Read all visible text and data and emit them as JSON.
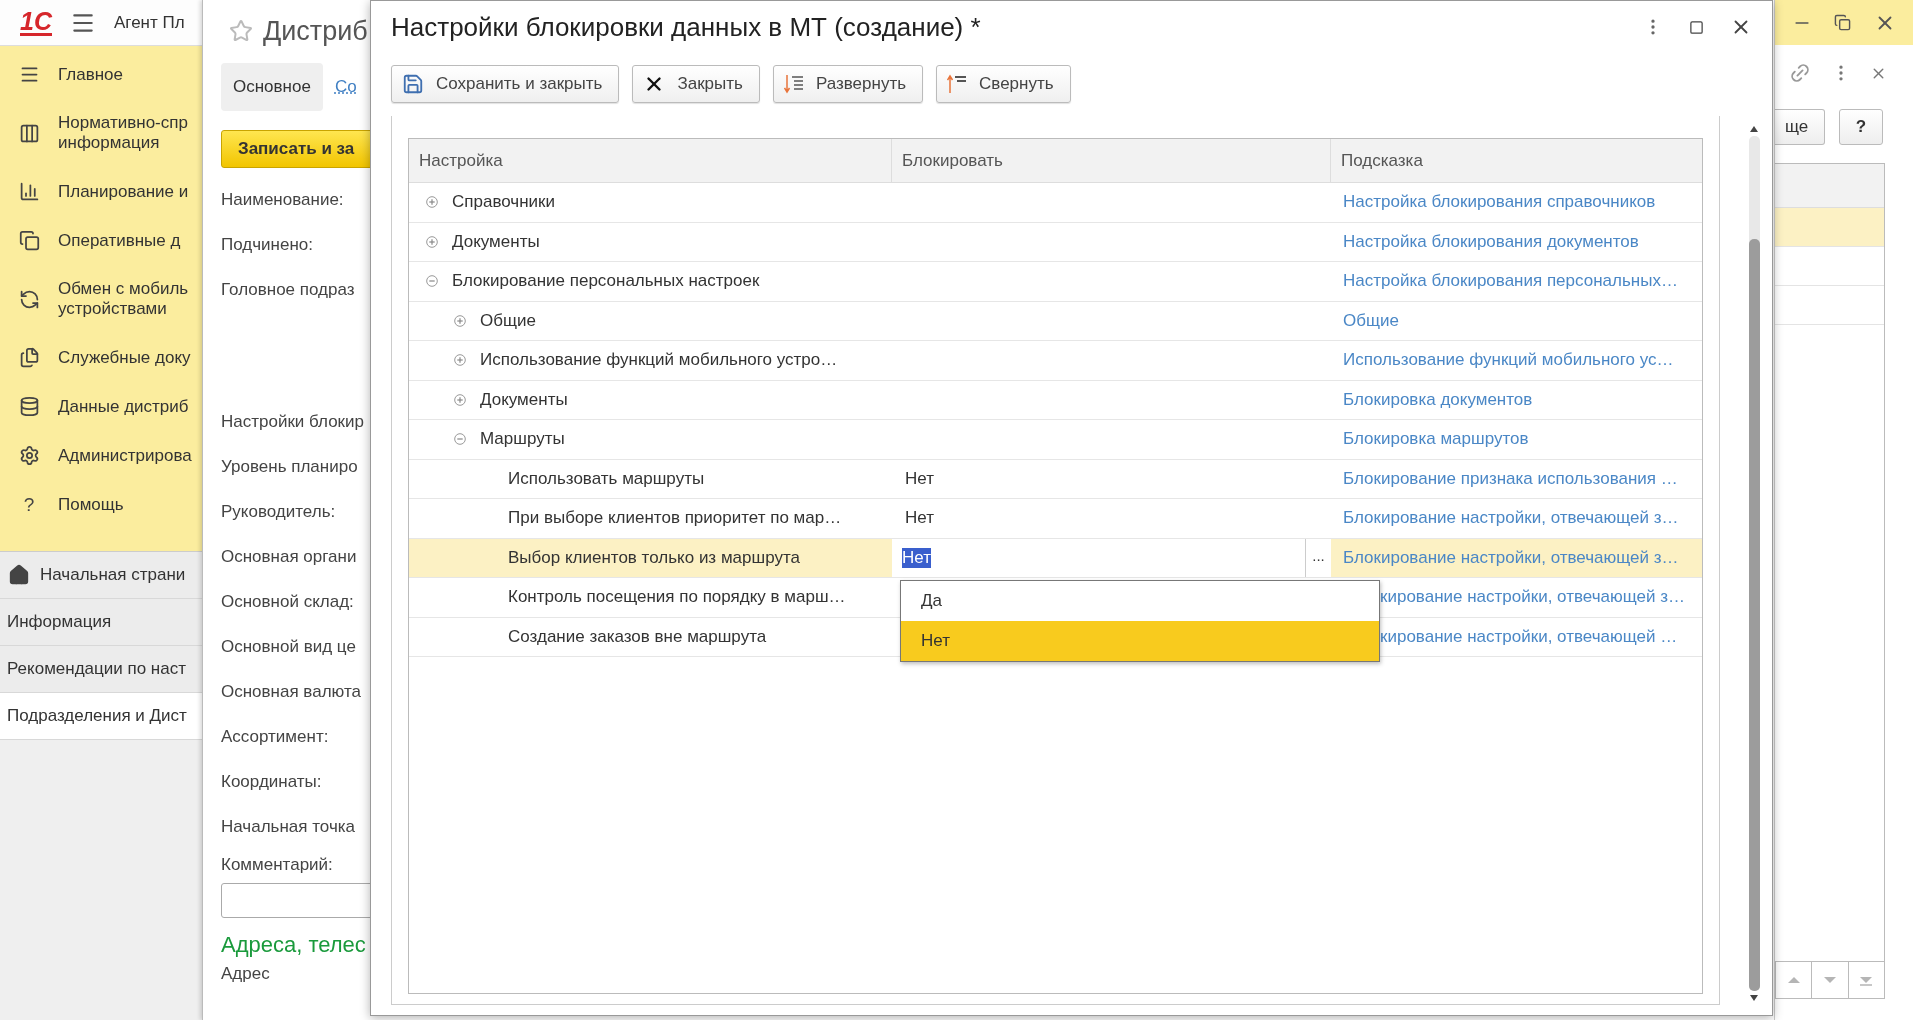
{
  "app": {
    "logo": "1С",
    "title": "Агент Пл"
  },
  "sections": [
    {
      "label": "Главное"
    },
    {
      "label": "Нормативно-спр информация"
    },
    {
      "label": "Планирование и"
    },
    {
      "label": "Оперативные д"
    },
    {
      "label": "Обмен с мобиль устройствами"
    },
    {
      "label": "Служебные доку"
    },
    {
      "label": "Данные дистриб"
    },
    {
      "label": "Администрирова"
    },
    {
      "label": "Помощь",
      "glyph": "?"
    }
  ],
  "nav": [
    {
      "label": "Начальная страни",
      "kind": "home",
      "selected": false
    },
    {
      "label": "Информация",
      "kind": "page",
      "selected": false
    },
    {
      "label": "Рекомендации по наст",
      "kind": "page",
      "selected": false
    },
    {
      "label": "Подразделения и Дист",
      "kind": "page",
      "selected": true
    }
  ],
  "form": {
    "title": "Дистриб",
    "tabs": [
      {
        "label": "Основное",
        "selected": true
      },
      {
        "label": "Со",
        "selected": false
      }
    ],
    "save_button": "Записать и за",
    "fields": [
      {
        "label": "Наименование:"
      },
      {
        "label": "Подчинено:"
      },
      {
        "label": "Головное подраз"
      },
      {
        "label": "Настройки блокир"
      },
      {
        "label": "Уровень планиро"
      },
      {
        "label": "Руководитель:"
      },
      {
        "label": "Основная органи"
      },
      {
        "label": "Основной склад:"
      },
      {
        "label": "Основной вид це"
      },
      {
        "label": "Основная валюта"
      },
      {
        "label": "Ассортимент:"
      },
      {
        "label": "Координаты:"
      },
      {
        "label": "Начальная точка"
      }
    ],
    "comment_label": "Комментарий:",
    "section_title": "Адреса, телес",
    "address_label": "Адрес",
    "more_button": "ще",
    "help_button": "?",
    "list_rows": [
      {
        "selected": true
      },
      {
        "selected": false
      },
      {
        "selected": false
      }
    ]
  },
  "dialog": {
    "title": "Настройки блокировки данных в МТ (создание) *",
    "toolbar": [
      {
        "label": "Сохранить и закрыть",
        "kind": "save"
      },
      {
        "label": "Закрыть",
        "kind": "close"
      },
      {
        "label": "Развернуть",
        "kind": "expand"
      },
      {
        "label": "Свернуть",
        "kind": "collapse"
      }
    ],
    "table": {
      "columns": [
        "Настройка",
        "Блокировать",
        "Подсказка"
      ],
      "choice_button": "...",
      "rows": [
        {
          "name": "Справочники",
          "expanded": false,
          "selected": false,
          "hint": "Настройка блокирования справочников"
        },
        {
          "name": "Документы",
          "expanded": false,
          "selected": false,
          "hint": "Настройка блокирования документов"
        },
        {
          "name": "Блокирование персональных настроек",
          "expanded": true,
          "selected": false,
          "hint": "Настройка блокирования персональных…",
          "children": [
            {
              "name": "Общие",
              "expanded": false,
              "selected": false,
              "hint": "Общие"
            },
            {
              "name": "Использование функций мобильного устро…",
              "expanded": false,
              "selected": false,
              "hint": "Использование функций мобильного ус…"
            },
            {
              "name": "Документы",
              "expanded": false,
              "selected": false,
              "hint": "Блокировка документов"
            },
            {
              "name": "Маршруты",
              "expanded": true,
              "selected": false,
              "hint": "Блокировка маршрутов",
              "children": [
                {
                  "name": "Использовать маршруты",
                  "value": "Нет",
                  "selected": false,
                  "hint": "Блокирование признака использования …"
                },
                {
                  "name": "При выборе клиентов приоритет по мар…",
                  "value": "Нет",
                  "selected": false,
                  "hint": "Блокирование настройки, отвечающей з…"
                },
                {
                  "name": "Выбор клиентов только из маршрута",
                  "value": "Нет",
                  "selected": true,
                  "hint": "Блокирование настройки, отвечающей з…"
                },
                {
                  "name": "Контроль посещения по порядку в марш…",
                  "selected": false,
                  "hint": "кирование настройки, отвечающей з…"
                },
                {
                  "name": "Создание заказов вне маршрута",
                  "selected": false,
                  "hint": "кирование настройки, отвечающей …"
                }
              ]
            }
          ]
        }
      ]
    },
    "dropdown": {
      "options": [
        {
          "label": "Да",
          "selected": false
        },
        {
          "label": "Нет",
          "selected": true
        }
      ]
    }
  }
}
